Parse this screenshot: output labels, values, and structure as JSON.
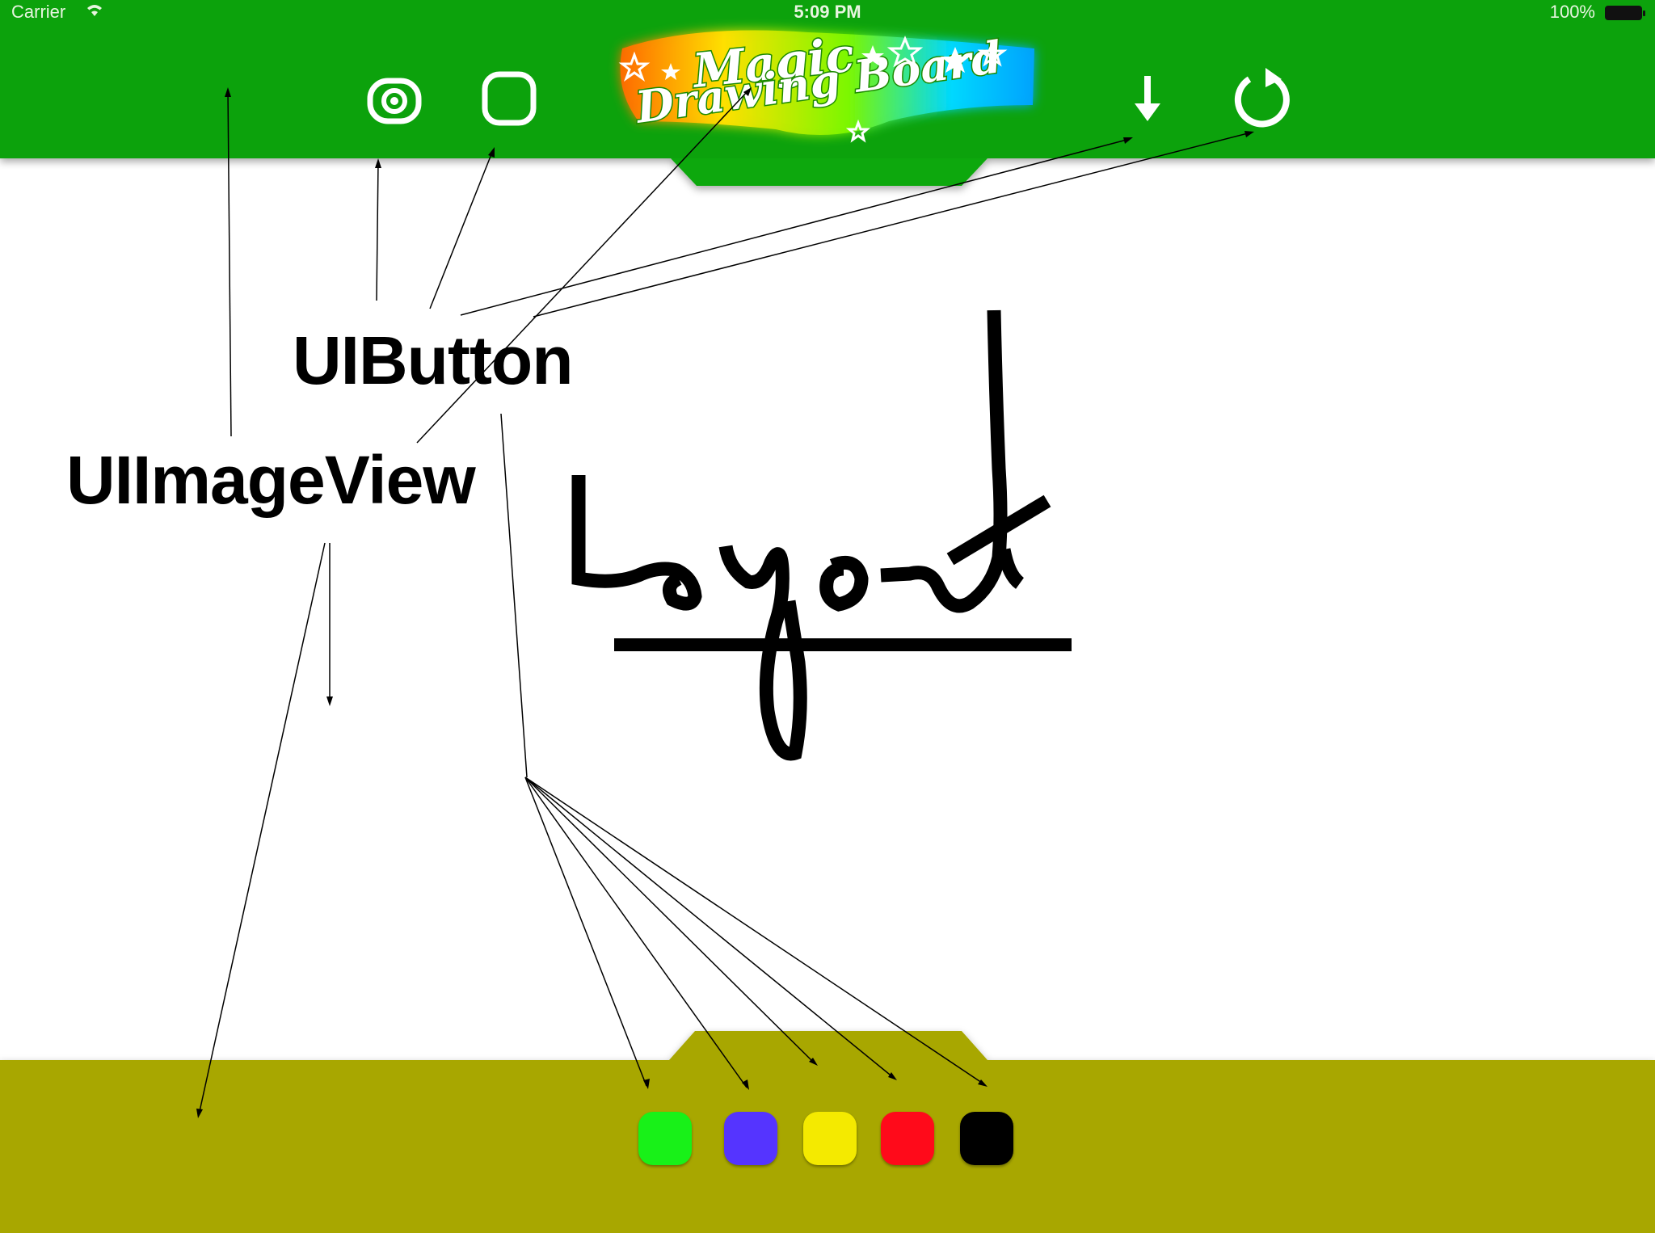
{
  "status_bar": {
    "carrier": "Carrier",
    "time": "5:09 PM",
    "battery": "100%"
  },
  "app": {
    "logo_line1": "Magic",
    "logo_line2": "Drawing Board"
  },
  "toolbar": {
    "icons": [
      "camera-icon",
      "rounded-square-icon",
      "download-arrow-icon",
      "refresh-icon"
    ]
  },
  "colors": {
    "top_bar": "#0fa80f",
    "bottom_bar": "#a8a700",
    "canvas": "#ffffff"
  },
  "palette": [
    {
      "name": "green",
      "color": "#18f118"
    },
    {
      "name": "blue",
      "color": "#5534ff"
    },
    {
      "name": "yellow",
      "color": "#f4ea00"
    },
    {
      "name": "red",
      "color": "#ff0a1a"
    },
    {
      "name": "black",
      "color": "#000000"
    }
  ],
  "annotations": {
    "button_label": "UIButton",
    "imageview_label": "UIImageView"
  }
}
